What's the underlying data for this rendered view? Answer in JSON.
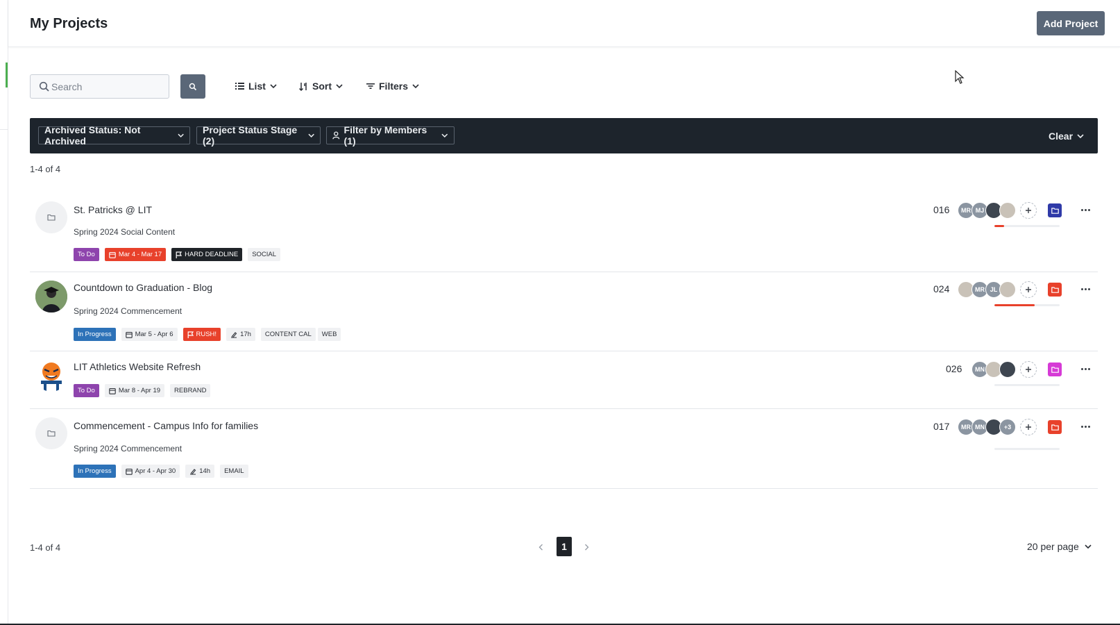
{
  "header": {
    "title": "My Projects",
    "add_button": "Add Project"
  },
  "toolbar": {
    "search_placeholder": "Search",
    "view_label": "List",
    "sort_label": "Sort",
    "filters_label": "Filters"
  },
  "filter_bar": {
    "chips": [
      "Archived Status: Not Archived",
      "Project Status Stage (2)",
      "Filter by Members (1)"
    ],
    "clear_label": "Clear"
  },
  "summary": {
    "top_count": "1-4 of 4",
    "bottom_count": "1-4 of 4"
  },
  "projects": [
    {
      "title": "St. Patricks @ LIT",
      "subtitle": "Spring 2024 Social Content",
      "id": "016",
      "status": "To Do",
      "dates": "Mar 4 - Mar 17",
      "flag": "HARD DEADLINE",
      "labels": [
        "SOCIAL"
      ],
      "members": [
        "MR",
        "MJ",
        "photo",
        "photo"
      ],
      "progress": 0.15,
      "folder_color": "#2f3aa8"
    },
    {
      "title": "Countdown to Graduation - Blog",
      "subtitle": "Spring 2024 Commencement",
      "id": "024",
      "status": "In Progress",
      "dates": "Mar 5 - Apr 6",
      "flag": "RUSH!",
      "time": "17h",
      "labels": [
        "CONTENT CAL",
        "WEB"
      ],
      "members": [
        "photo",
        "MR",
        "JL",
        "photo"
      ],
      "progress": 0.62,
      "folder_color": "#e8412b"
    },
    {
      "title": "LIT Athletics Website Refresh",
      "subtitle": "",
      "id": "026",
      "status": "To Do",
      "dates": "Mar 8 - Apr 19",
      "labels": [
        "REBRAND"
      ],
      "members": [
        "MN",
        "photo",
        "photo"
      ],
      "progress": 0,
      "folder_color": "#d63ad6"
    },
    {
      "title": "Commencement - Campus Info for families",
      "subtitle": "Spring 2024 Commencement",
      "id": "017",
      "status": "In Progress",
      "dates": "Apr 4 - Apr 30",
      "time": "14h",
      "labels": [
        "EMAIL"
      ],
      "members": [
        "MR",
        "MN",
        "photo",
        "+3"
      ],
      "progress": 0,
      "folder_color": "#e8412b"
    }
  ],
  "pagination": {
    "current_page": "1",
    "per_page": "20 per page"
  }
}
